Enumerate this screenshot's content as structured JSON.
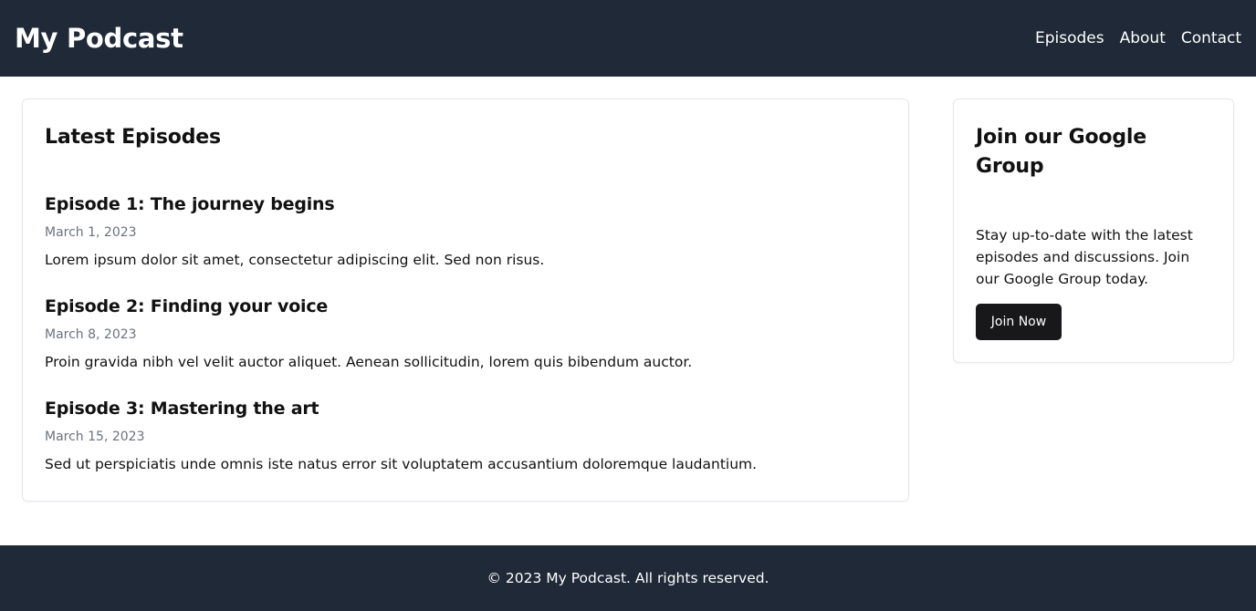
{
  "header": {
    "site_title": "My Podcast",
    "nav": [
      {
        "label": "Episodes"
      },
      {
        "label": "About"
      },
      {
        "label": "Contact"
      }
    ]
  },
  "episodes_section": {
    "title": "Latest Episodes",
    "episodes": [
      {
        "title": "Episode 1: The journey begins",
        "date": "March 1, 2023",
        "description": "Lorem ipsum dolor sit amet, consectetur adipiscing elit. Sed non risus."
      },
      {
        "title": "Episode 2: Finding your voice",
        "date": "March 8, 2023",
        "description": "Proin gravida nibh vel velit auctor aliquet. Aenean sollicitudin, lorem quis bibendum auctor."
      },
      {
        "title": "Episode 3: Mastering the art",
        "date": "March 15, 2023",
        "description": "Sed ut perspiciatis unde omnis iste natus error sit voluptatem accusantium doloremque laudantium."
      }
    ]
  },
  "google_group": {
    "title": "Join our Google Group",
    "text": "Stay up-to-date with the latest episodes and discussions. Join our Google Group today.",
    "button_label": "Join Now"
  },
  "footer": {
    "text": "© 2023 My Podcast. All rights reserved."
  },
  "colors": {
    "header_bg": "#1f2937",
    "button_bg": "#18181b",
    "date_text": "#6b7280"
  }
}
